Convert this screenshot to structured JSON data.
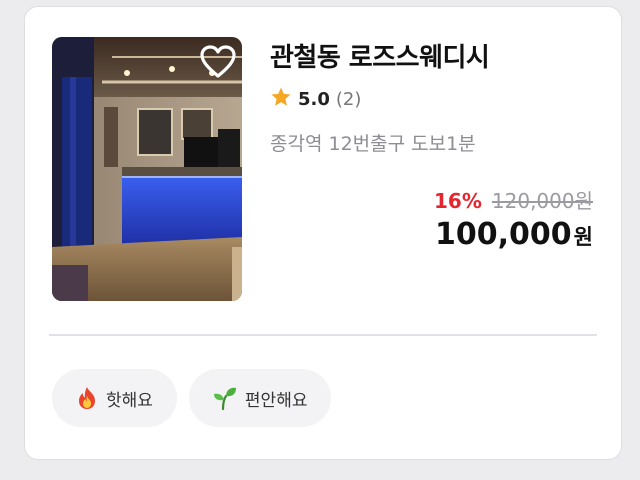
{
  "listing": {
    "title": "관철동 로즈스웨디시",
    "rating": "5.0",
    "review_count": "(2)",
    "location": "종각역 12번출구 도보1분",
    "discount": "16%",
    "original_price": "120,000원",
    "final_price": "100,000",
    "currency_unit": "원",
    "favorite_icon": "heart-outline-icon",
    "rating_icon": "star-icon",
    "image_subject": "interior"
  },
  "tags": [
    {
      "label": "핫해요",
      "icon": "fire-icon"
    },
    {
      "label": "편안해요",
      "icon": "sprout-icon"
    }
  ],
  "colors": {
    "discount": "#e5262e",
    "star": "#f5a623",
    "tag_background": "#f3f3f6"
  }
}
